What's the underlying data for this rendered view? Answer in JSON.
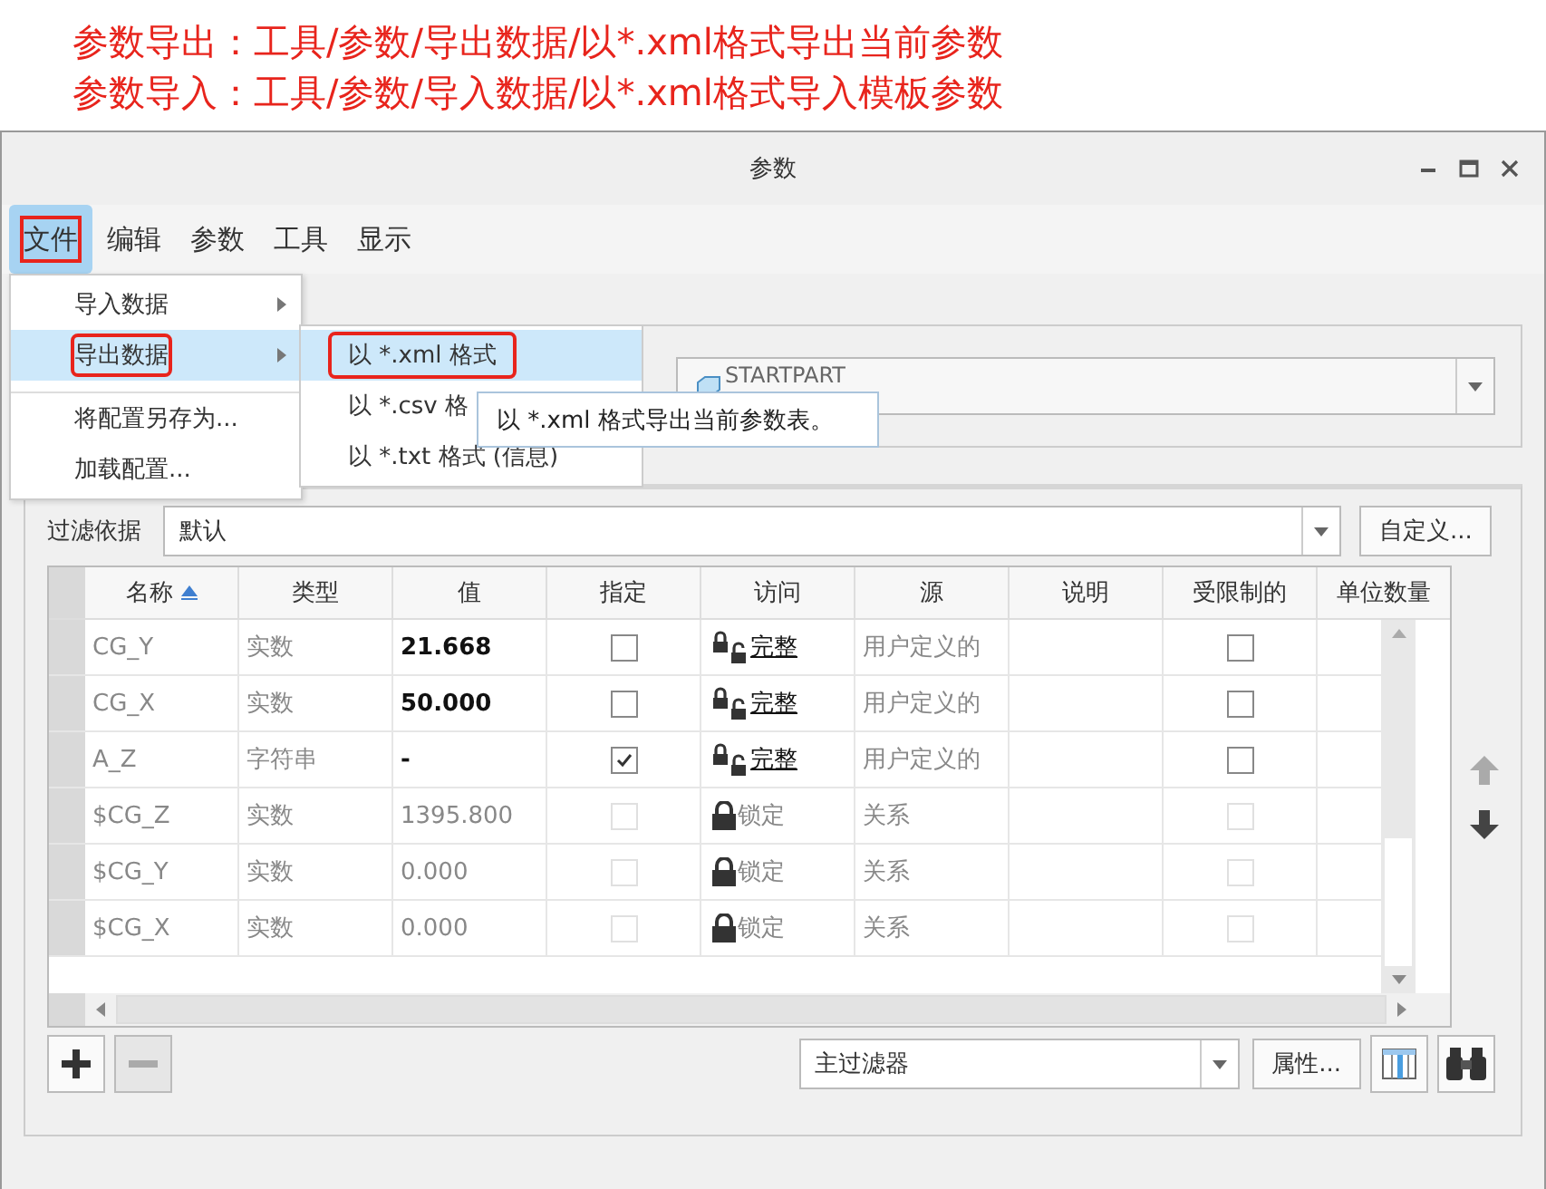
{
  "annotations": [
    "参数导出：工具/参数/导出数据/以*.xml格式导出当前参数",
    "参数导入：工具/参数/导入数据/以*.xml格式导入模板参数"
  ],
  "window": {
    "title": "参数"
  },
  "menubar": [
    {
      "label": "文件",
      "selected": true,
      "annotated": true
    },
    {
      "label": "编辑",
      "selected": false,
      "annotated": false
    },
    {
      "label": "参数",
      "selected": false,
      "annotated": false
    },
    {
      "label": "工具",
      "selected": false,
      "annotated": false
    },
    {
      "label": "显示",
      "selected": false,
      "annotated": false
    }
  ],
  "file_menu": [
    {
      "label": "导入数据",
      "submenu": true,
      "selected": false,
      "annotated": false,
      "separator_before": false
    },
    {
      "label": "导出数据",
      "submenu": true,
      "selected": true,
      "annotated": true,
      "separator_before": false
    },
    {
      "label": "将配置另存为...",
      "submenu": false,
      "selected": false,
      "annotated": false,
      "separator_before": true
    },
    {
      "label": "加载配置...",
      "submenu": false,
      "selected": false,
      "annotated": false,
      "separator_before": false
    }
  ],
  "export_submenu": [
    {
      "label": "以 *.xml 格式",
      "selected": true,
      "annotated": true
    },
    {
      "label": "以 *.csv 格",
      "selected": false,
      "annotated": false
    },
    {
      "label": "以 *.txt 格式 (信息)",
      "selected": false,
      "annotated": false
    }
  ],
  "tooltip": "以 *.xml 格式导出当前参数表。",
  "object_field": {
    "value": "STARTPART"
  },
  "filter": {
    "label": "过滤依据",
    "value": "默认",
    "button": "自定义..."
  },
  "table": {
    "columns": [
      {
        "label": "名称",
        "sorted": true
      },
      {
        "label": "类型",
        "sorted": false
      },
      {
        "label": "值",
        "sorted": false
      },
      {
        "label": "指定",
        "sorted": false
      },
      {
        "label": "访问",
        "sorted": false
      },
      {
        "label": "源",
        "sorted": false
      },
      {
        "label": "说明",
        "sorted": false
      },
      {
        "label": "受限制的",
        "sorted": false
      },
      {
        "label": "单位数量",
        "sorted": false
      }
    ],
    "rows": [
      {
        "name": "CG_Y",
        "type": "实数",
        "value": "21.668",
        "specified": false,
        "access": "完整",
        "source": "用户定义的",
        "restricted": false,
        "locked": false
      },
      {
        "name": "CG_X",
        "type": "实数",
        "value": "50.000",
        "specified": false,
        "access": "完整",
        "source": "用户定义的",
        "restricted": false,
        "locked": false
      },
      {
        "name": "A_Z",
        "type": "字符串",
        "value": "-",
        "specified": true,
        "access": "完整",
        "source": "用户定义的",
        "restricted": false,
        "locked": false
      },
      {
        "name": "$CG_Z",
        "type": "实数",
        "value": "1395.800",
        "specified": false,
        "access": "锁定",
        "source": "关系",
        "restricted": false,
        "locked": true
      },
      {
        "name": "$CG_Y",
        "type": "实数",
        "value": "0.000",
        "specified": false,
        "access": "锁定",
        "source": "关系",
        "restricted": false,
        "locked": true
      },
      {
        "name": "$CG_X",
        "type": "实数",
        "value": "0.000",
        "specified": false,
        "access": "锁定",
        "source": "关系",
        "restricted": false,
        "locked": true
      }
    ]
  },
  "bottom": {
    "filter_value": "主过滤器",
    "properties_button": "属性..."
  }
}
